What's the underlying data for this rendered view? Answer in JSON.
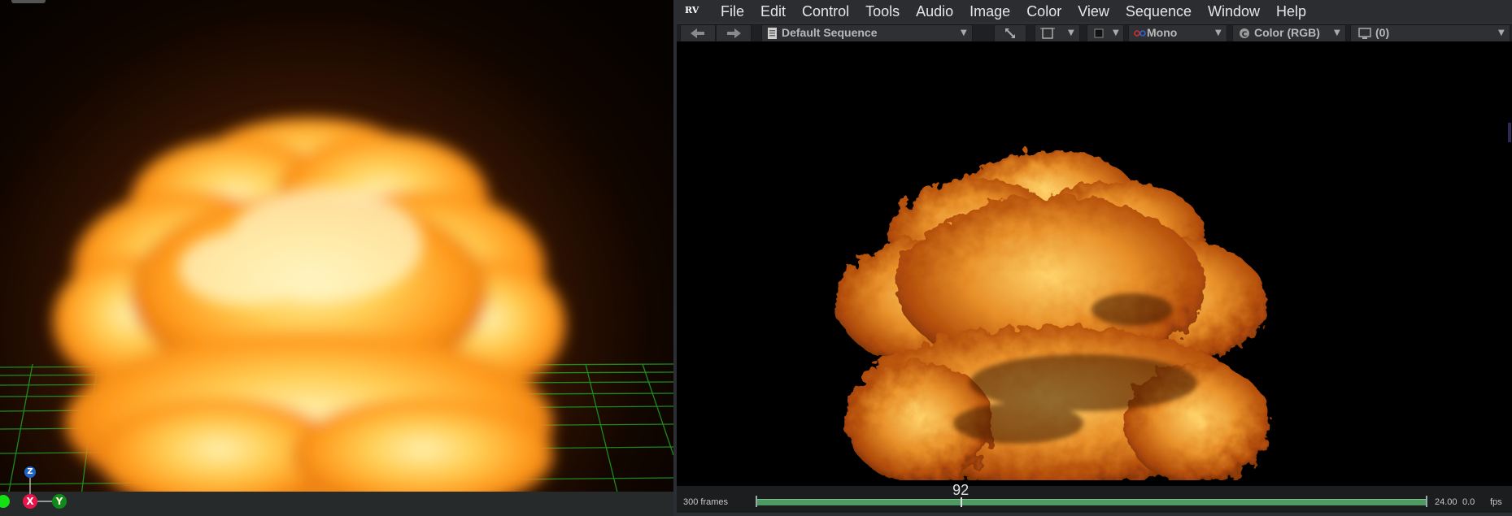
{
  "left_viewport": {
    "axis": {
      "x": "X",
      "y": "Y",
      "z": "Z"
    }
  },
  "rv": {
    "logo": "RV",
    "menu": [
      "File",
      "Edit",
      "Control",
      "Tools",
      "Audio",
      "Image",
      "Color",
      "View",
      "Sequence",
      "Window",
      "Help"
    ],
    "toolbar": {
      "sequence": "Default Sequence",
      "stereo": "Mono",
      "channel": "Color (RGB)",
      "output": "(0)"
    },
    "timeline": {
      "frames": "300 frames",
      "current_frame": "92",
      "fps": "24.00",
      "fps_actual": "0.0",
      "fps_unit": "fps",
      "progress": 0.306
    }
  },
  "colors": {
    "track": "#4f9a63",
    "fire_core": "#ffd36a",
    "fire_edge": "#b04a08"
  }
}
